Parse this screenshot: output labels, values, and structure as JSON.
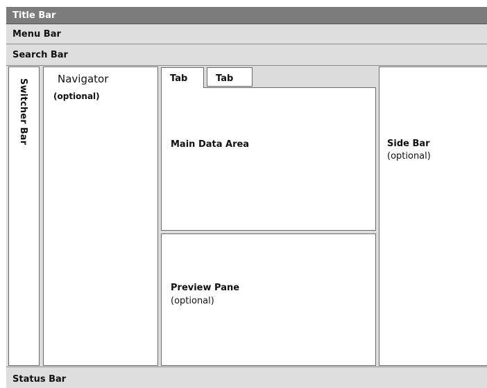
{
  "title_bar": {
    "label": "Title Bar"
  },
  "menu_bar": {
    "label": "Menu Bar"
  },
  "search_bar": {
    "label": "Search Bar"
  },
  "switcher_bar": {
    "label": "Switcher Bar"
  },
  "navigator": {
    "label": "Navigator",
    "note": "(optional)"
  },
  "tabs": [
    {
      "label": "Tab"
    },
    {
      "label": "Tab"
    }
  ],
  "main_data_area": {
    "label": "Main Data Area"
  },
  "preview_pane": {
    "label": "Preview Pane",
    "note": "(optional)"
  },
  "side_bar": {
    "label": "Side Bar",
    "note": "(optional)"
  },
  "status_bar": {
    "label": "Status Bar"
  },
  "colors": {
    "title_bar": "#7c7c7c",
    "bars": "#dedede",
    "panel": "#ffffff",
    "border": "#6a6a6a"
  }
}
